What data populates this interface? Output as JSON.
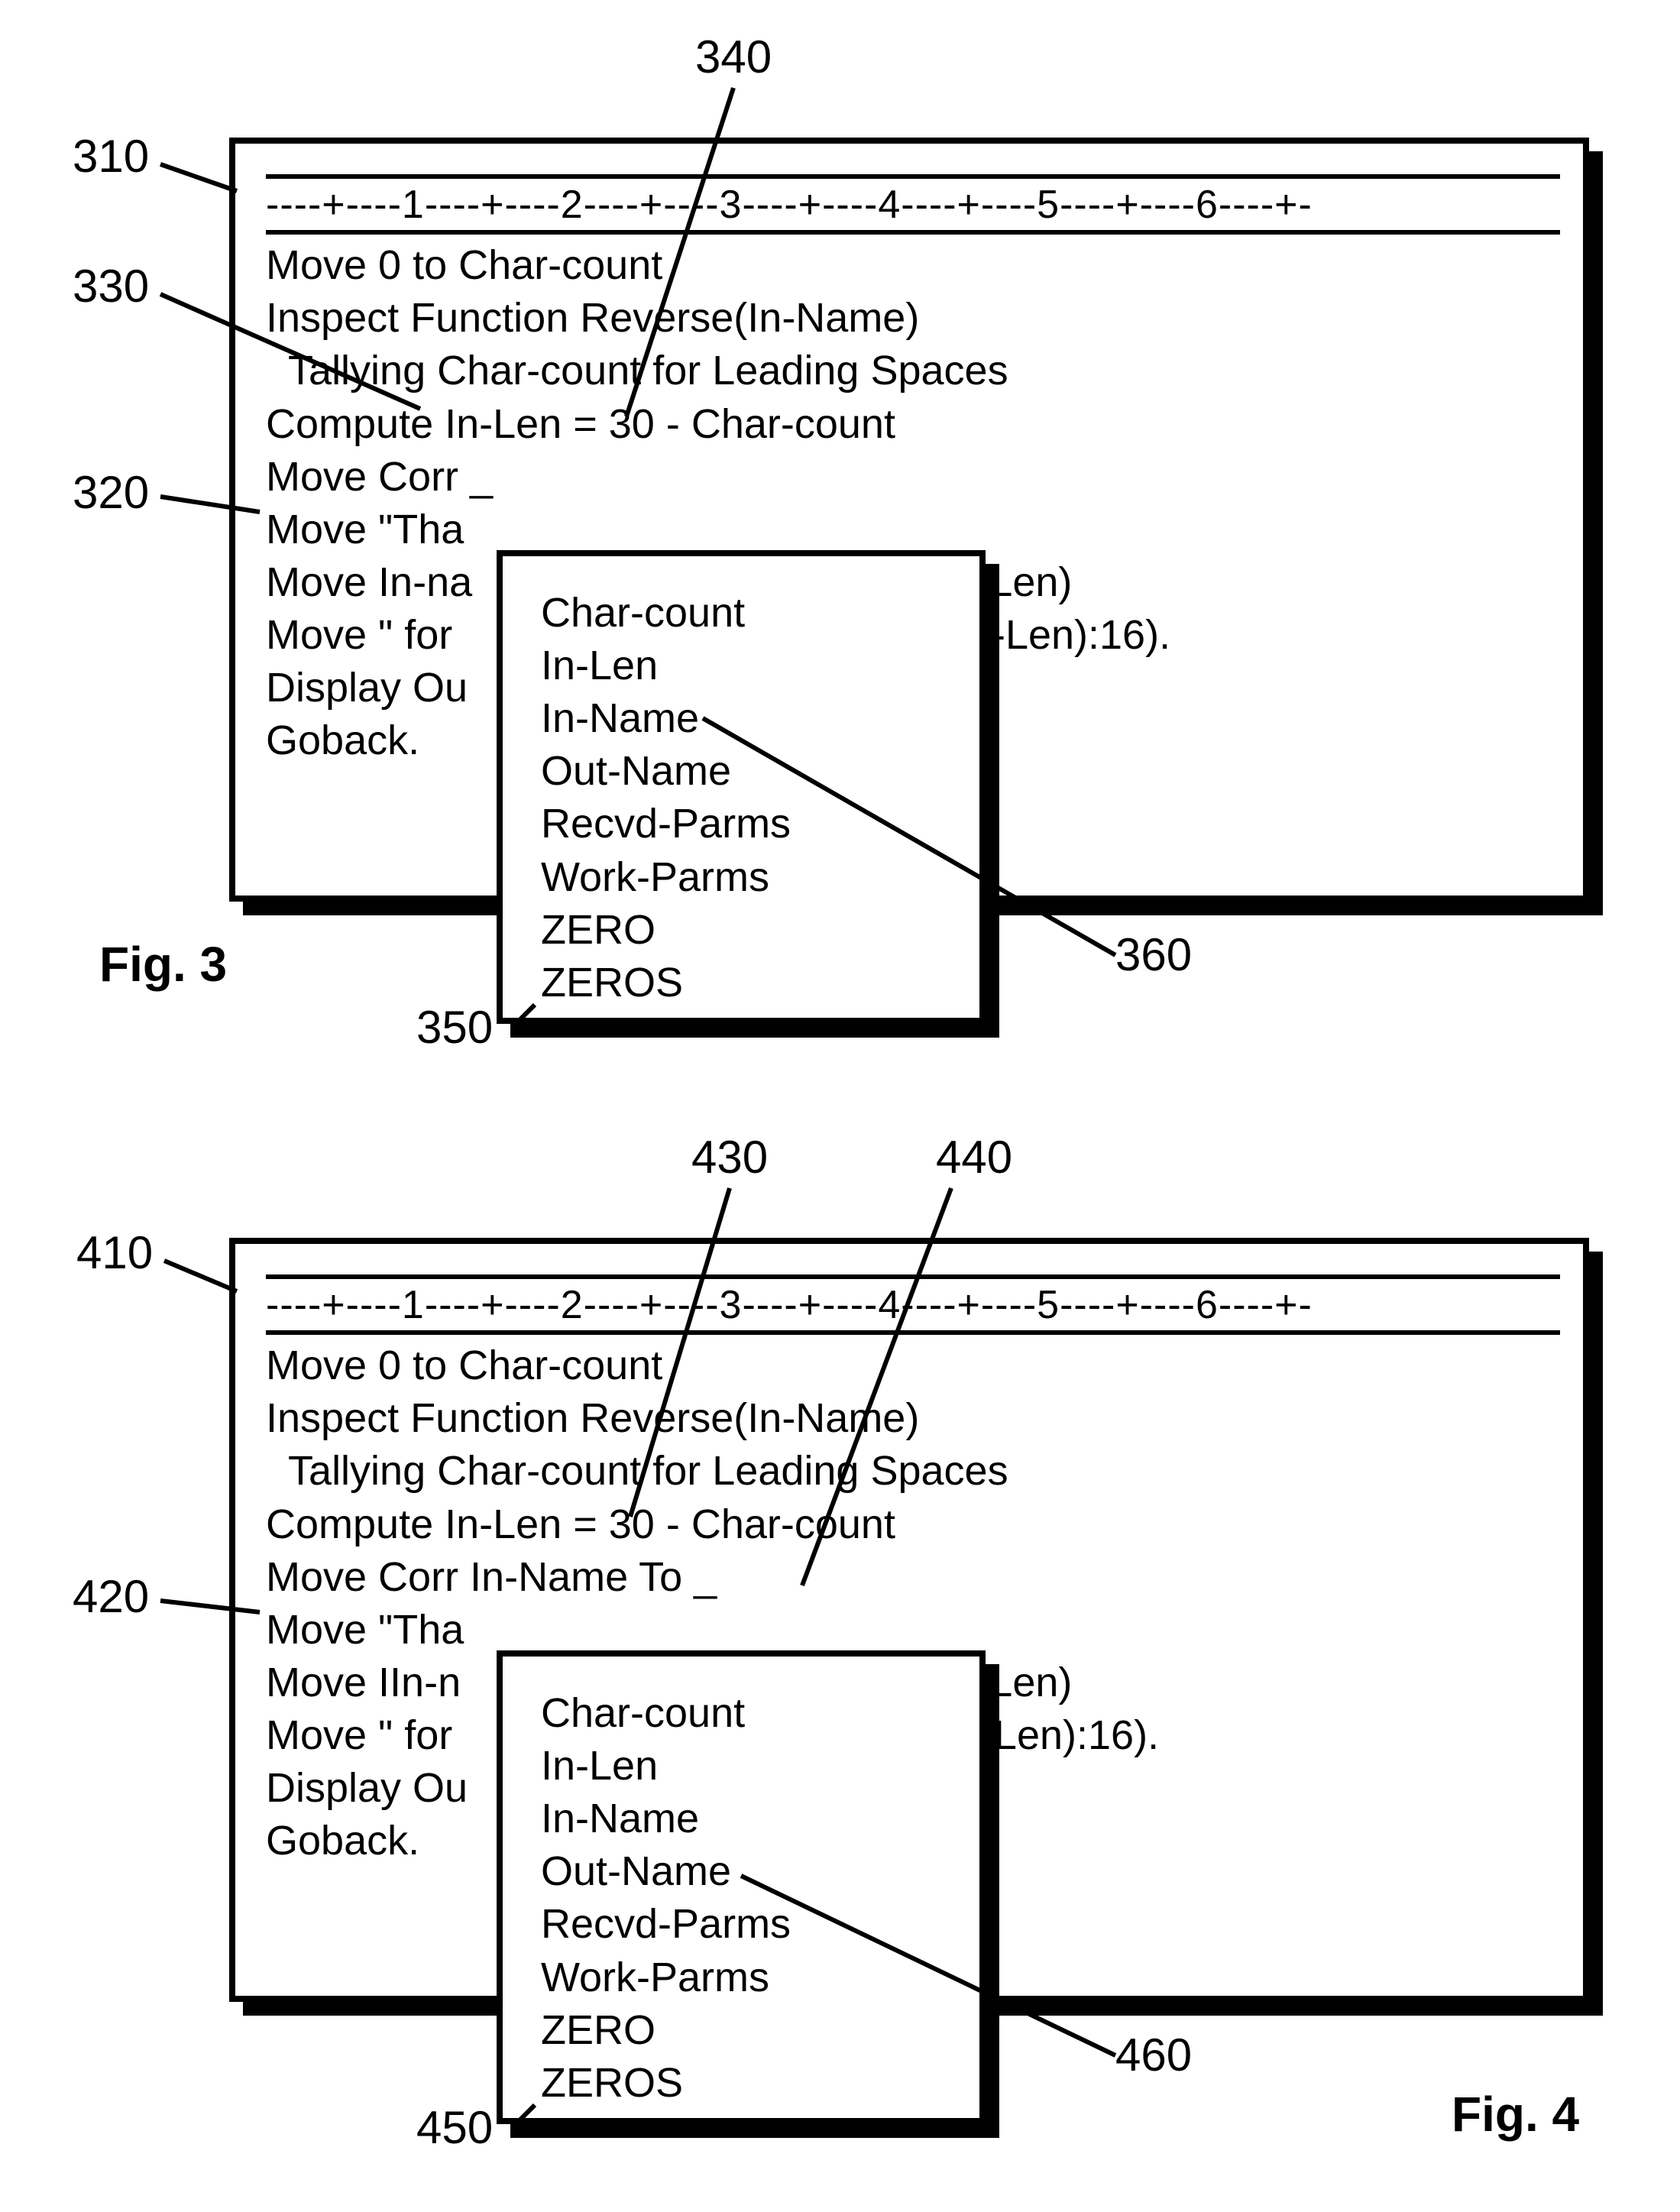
{
  "labels": {
    "l310": "310",
    "l320": "320",
    "l330": "330",
    "l340": "340",
    "l350": "350",
    "l360": "360",
    "l410": "410",
    "l420": "420",
    "l430": "430",
    "l440": "440",
    "l450": "450",
    "l460": "460",
    "fig3": "Fig. 3",
    "fig4": "Fig. 4"
  },
  "fig3": {
    "ruler": "----+----1----+----2----+----3----+----4----+----5----+----6----+-",
    "code": [
      "Move 0 to Char-count",
      "Inspect Function Reverse(In-Name)",
      "  Tallying Char-count for Leading Spaces",
      "Compute In-Len = 30 - Char-count",
      "Move Corr _",
      "Move \"Tha",
      "Move In-na                                   (11:In-Len)",
      "Move \" for                                   (11 + In-Len):16).",
      "Display Ou",
      "Goback."
    ],
    "popup": [
      "Char-count",
      "In-Len",
      "In-Name",
      "Out-Name",
      "Recvd-Parms",
      "Work-Parms",
      "ZERO",
      "ZEROS"
    ]
  },
  "fig4": {
    "ruler": "----+----1----+----2----+----3----+----4----+----5----+----6----+-",
    "code": [
      "Move 0 to Char-count",
      "Inspect Function Reverse(In-Name)",
      "  Tallying Char-count for Leading Spaces",
      "Compute In-Len = 30 - Char-count",
      "Move Corr In-Name To _",
      "Move \"Tha",
      "Move IIn-n                                 e (11:In-Len)",
      "Move \" for                                  (11 + In-Len):16).",
      "Display Ou",
      "Goback."
    ],
    "popup": [
      "Char-count",
      "In-Len",
      "In-Name",
      "Out-Name",
      "Recvd-Parms",
      "Work-Parms",
      "ZERO",
      "ZEROS"
    ]
  }
}
